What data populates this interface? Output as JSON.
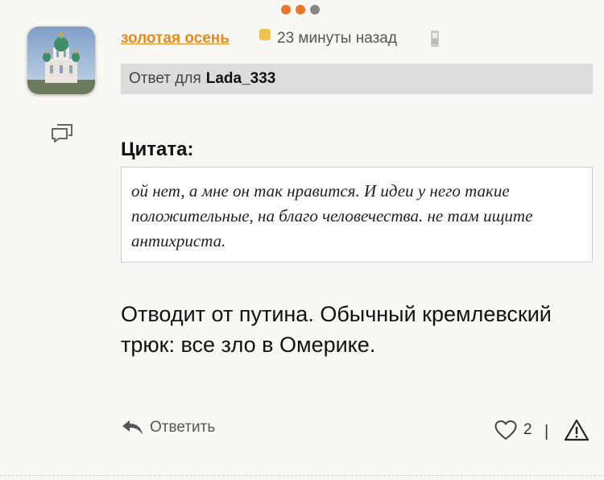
{
  "pager": {
    "dots": [
      "#e8772a",
      "#e8772a",
      "#888888"
    ]
  },
  "comment": {
    "author": "золотая осень",
    "timestamp": "23 минуты назад",
    "reply_prefix": "Ответ для",
    "reply_to_user": "Lada_333",
    "quote_title": "Цитата:",
    "quote_text": "ой нет, а мне он так нравится. И идеи у него такие положительные, на благо человечества. не там ищите антихриста.",
    "body": "Отводит от путина. Обычный кремлевский трюк: все зло в Омерике."
  },
  "actions": {
    "reply_label": "Ответить",
    "like_count": "2",
    "divider": "|"
  },
  "colors": {
    "accent": "#e98a1a",
    "badge": "#f1c14d",
    "reply_bar": "#dcdcdc"
  },
  "icons": [
    "avatar-church-image",
    "replies-icon",
    "mobile-phone-icon",
    "reply-arrow-icon",
    "heart-icon",
    "warning-icon"
  ]
}
